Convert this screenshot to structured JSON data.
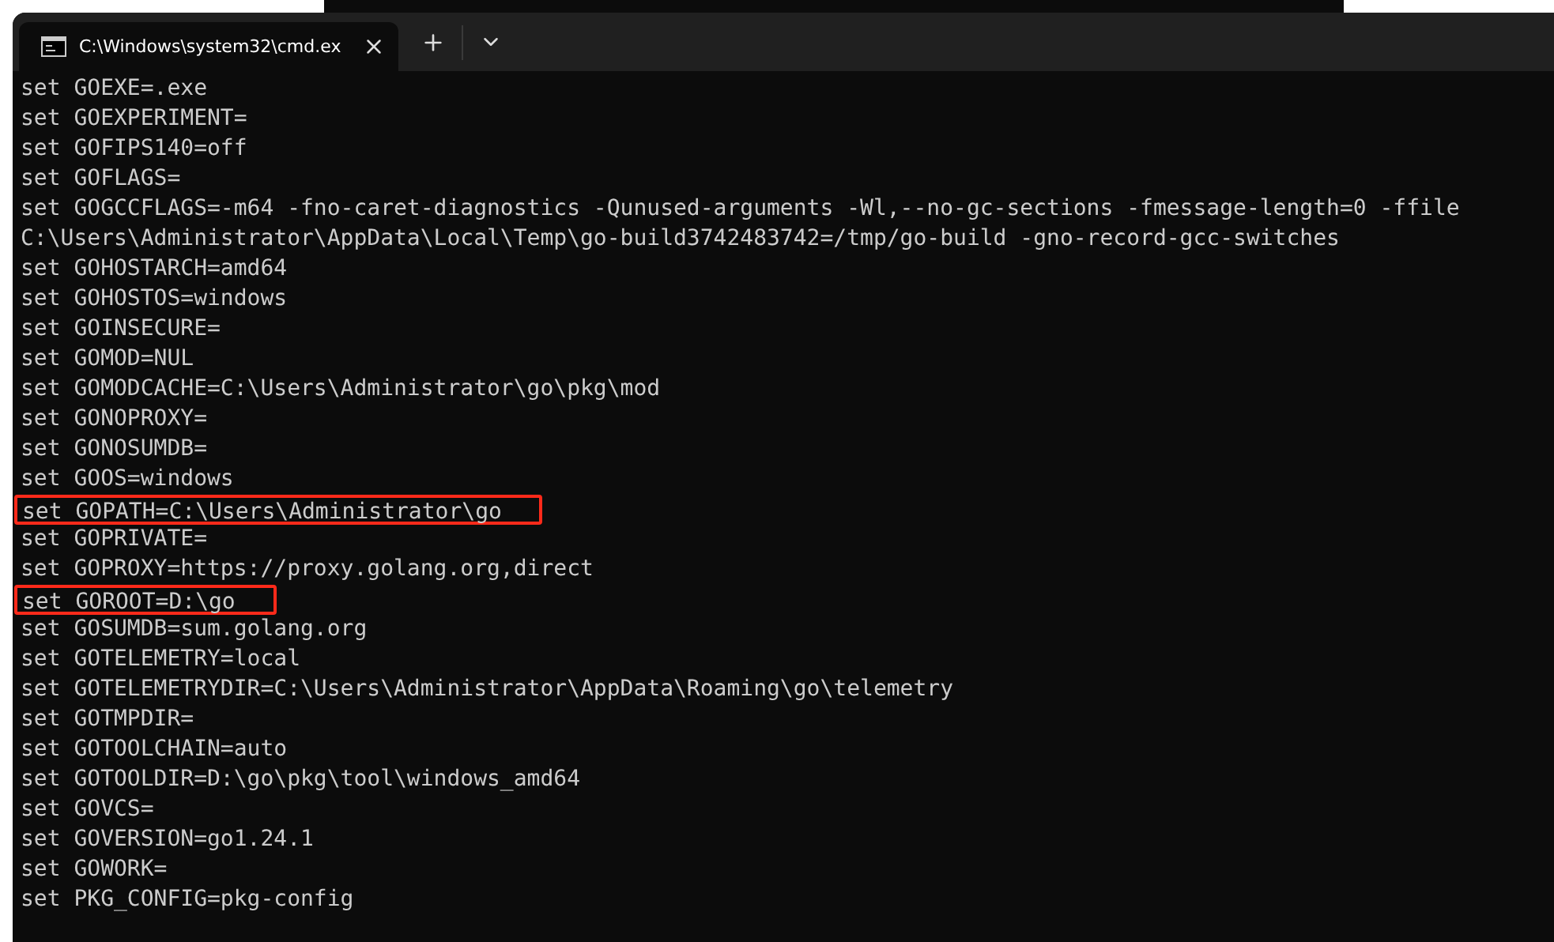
{
  "tabs": [
    {
      "title": "C:\\Windows\\system32\\cmd.ex",
      "selected": true
    }
  ],
  "lines": [
    {
      "text": "set GOEXE=.exe",
      "highlighted": false
    },
    {
      "text": "set GOEXPERIMENT=",
      "highlighted": false
    },
    {
      "text": "set GOFIPS140=off",
      "highlighted": false
    },
    {
      "text": "set GOFLAGS=",
      "highlighted": false
    },
    {
      "text": "set GOGCCFLAGS=-m64 -fno-caret-diagnostics -Qunused-arguments -Wl,--no-gc-sections -fmessage-length=0 -ffile",
      "highlighted": false
    },
    {
      "text": "C:\\Users\\Administrator\\AppData\\Local\\Temp\\go-build3742483742=/tmp/go-build -gno-record-gcc-switches",
      "highlighted": false
    },
    {
      "text": "set GOHOSTARCH=amd64",
      "highlighted": false
    },
    {
      "text": "set GOHOSTOS=windows",
      "highlighted": false
    },
    {
      "text": "set GOINSECURE=",
      "highlighted": false
    },
    {
      "text": "set GOMOD=NUL",
      "highlighted": false
    },
    {
      "text": "set GOMODCACHE=C:\\Users\\Administrator\\go\\pkg\\mod",
      "highlighted": false
    },
    {
      "text": "set GONOPROXY=",
      "highlighted": false
    },
    {
      "text": "set GONOSUMDB=",
      "highlighted": false
    },
    {
      "text": "set GOOS=windows",
      "highlighted": false
    },
    {
      "text": "set GOPATH=C:\\Users\\Administrator\\go",
      "highlighted": true
    },
    {
      "text": "set GOPRIVATE=",
      "highlighted": false
    },
    {
      "text": "set GOPROXY=https://proxy.golang.org,direct",
      "highlighted": false
    },
    {
      "text": "set GOROOT=D:\\go",
      "highlighted": true
    },
    {
      "text": "set GOSUMDB=sum.golang.org",
      "highlighted": false
    },
    {
      "text": "set GOTELEMETRY=local",
      "highlighted": false
    },
    {
      "text": "set GOTELEMETRYDIR=C:\\Users\\Administrator\\AppData\\Roaming\\go\\telemetry",
      "highlighted": false
    },
    {
      "text": "set GOTMPDIR=",
      "highlighted": false
    },
    {
      "text": "set GOTOOLCHAIN=auto",
      "highlighted": false
    },
    {
      "text": "set GOTOOLDIR=D:\\go\\pkg\\tool\\windows_amd64",
      "highlighted": false
    },
    {
      "text": "set GOVCS=",
      "highlighted": false
    },
    {
      "text": "set GOVERSION=go1.24.1",
      "highlighted": false
    },
    {
      "text": "set GOWORK=",
      "highlighted": false
    },
    {
      "text": "set PKG_CONFIG=pkg-config",
      "highlighted": false
    }
  ]
}
